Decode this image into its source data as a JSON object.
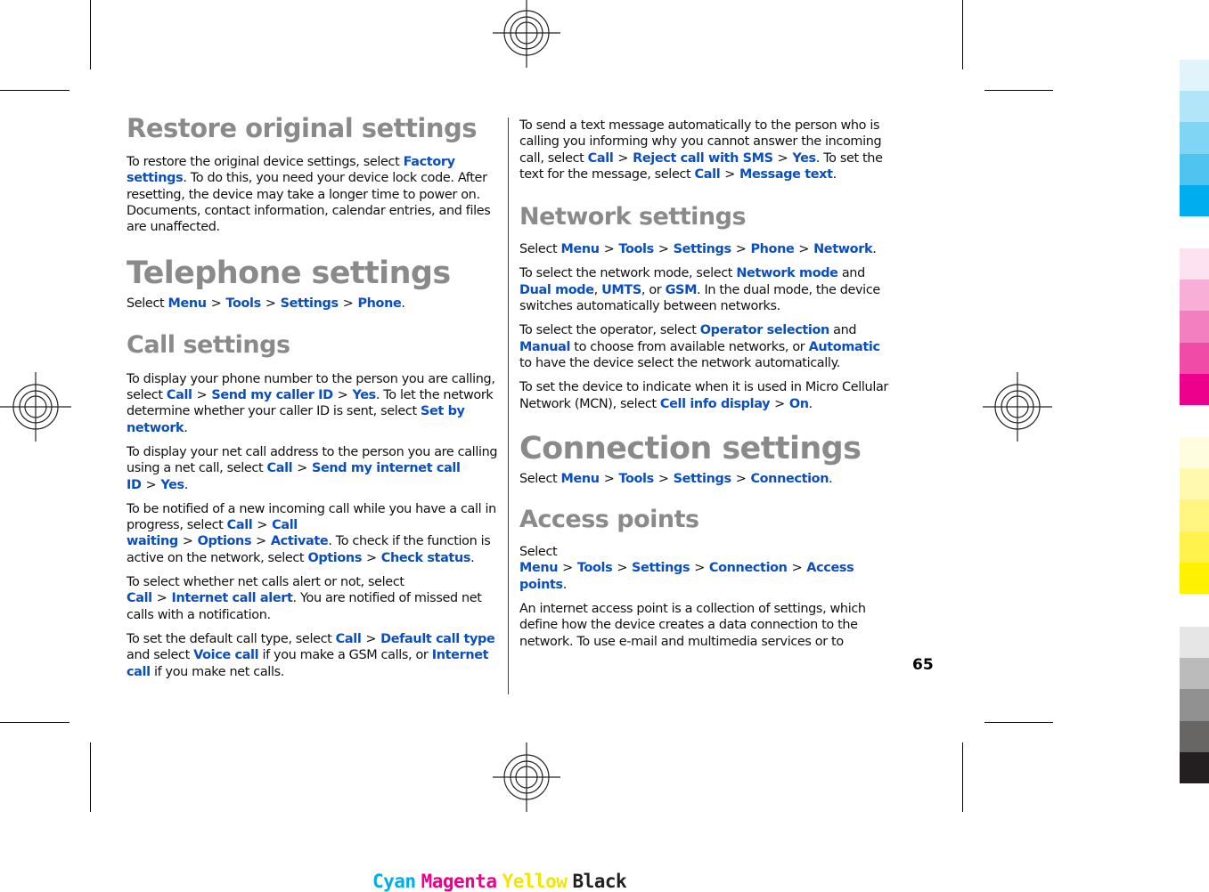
{
  "page_number": "65",
  "left_column": {
    "restore": {
      "title": "Restore original settings",
      "p1": [
        "To restore the original device settings, select ",
        "Factory settings",
        ". To do this, you need your device lock code. After resetting, the device may take a longer time to power on. Documents, contact information, calendar entries, and files are unaffected."
      ]
    },
    "telephone": {
      "title": "Telephone settings",
      "path_prefix": "Select ",
      "path": [
        "Menu",
        "Tools",
        "Settings",
        "Phone"
      ],
      "path_suffix": "."
    },
    "call_settings": {
      "title": "Call settings",
      "p1": {
        "t1": "To display your phone number to the person you are calling, select ",
        "l1": "Call",
        "l2": "Send my caller ID",
        "l3": "Yes",
        "t2": ". To let the network determine whether your caller ID is sent, select ",
        "l4": "Set by network",
        "t3": "."
      },
      "p2": {
        "t1": "To display your net call address to the person you are calling using a net call, select ",
        "l1": "Call",
        "l2": "Send my internet call ID",
        "l3": "Yes",
        "t2": "."
      },
      "p3": {
        "t1": "To be notified of a new incoming call while you have a call in progress, select ",
        "l1": "Call",
        "l2": "Call waiting",
        "l3": "Options",
        "l4": "Activate",
        "t2": ". To check if the function is active on the network, select ",
        "l5": "Options",
        "l6": "Check status",
        "t3": "."
      },
      "p4": {
        "t1": "To select whether net calls alert or not, select ",
        "l1": "Call",
        "l2": "Internet call alert",
        "t2": ". You are notified of missed net calls with a notification."
      },
      "p5": {
        "t1": "To set the default call type, select ",
        "l1": "Call",
        "l2": "Default call type",
        "t2": " and select ",
        "l3": "Voice call",
        "t3": " if you make a GSM calls, or ",
        "l4": "Internet call",
        "t4": " if you make net calls."
      }
    }
  },
  "right_column": {
    "sms": {
      "t1": "To send a text message automatically to the person who is calling you informing why you cannot answer the incoming call, select ",
      "l1": "Call",
      "l2": "Reject call with SMS",
      "l3": "Yes",
      "t2": ". To set the text for the message, select ",
      "l4": "Call",
      "l5": "Message text",
      "t3": "."
    },
    "network": {
      "title": "Network settings",
      "path_prefix": "Select ",
      "path": [
        "Menu",
        "Tools",
        "Settings",
        "Phone",
        "Network"
      ],
      "path_suffix": ".",
      "p1": {
        "t1": "To select the network mode, select ",
        "l1": "Network mode",
        "t2": " and ",
        "l2": "Dual mode",
        "t3": ", ",
        "l3": "UMTS",
        "t4": ", or ",
        "l4": "GSM",
        "t5": ". In the dual mode, the device switches automatically between networks."
      },
      "p2": {
        "t1": "To select the operator, select ",
        "l1": "Operator selection",
        "t2": " and ",
        "l2": "Manual",
        "t3": " to choose from available networks, or ",
        "l3": "Automatic",
        "t4": " to have the device select the network automatically."
      },
      "p3": {
        "t1": "To set the device to indicate when it is used in Micro Cellular Network (MCN), select ",
        "l1": "Cell info display",
        "l2": "On",
        "t2": "."
      }
    },
    "connection": {
      "title": "Connection settings",
      "path_prefix": "Select ",
      "path": [
        "Menu",
        "Tools",
        "Settings",
        "Connection"
      ],
      "path_suffix": "."
    },
    "access_points": {
      "title": "Access points",
      "path_prefix": "Select ",
      "path": [
        "Menu",
        "Tools",
        "Settings",
        "Connection",
        "Access points"
      ],
      "path_suffix": ".",
      "p1": "An internet access point is a collection of settings, which define how the device creates a data connection to the network. To use e-mail and multimedia services or to"
    }
  },
  "separator": ">",
  "print_colors": {
    "cyan": [
      "#e1f4fc",
      "#b3e5f8",
      "#80d5f5",
      "#4fc4f1",
      "#00aeef"
    ],
    "magenta": [
      "#fde3f1",
      "#f8afd7",
      "#f47fc0",
      "#f04ca7",
      "#ec008c"
    ],
    "yellow": [
      "#fffde0",
      "#fff9b0",
      "#fff580",
      "#fff24d",
      "#fff200"
    ],
    "black": [
      "#e6e6e6",
      "#bcbbbb",
      "#929191",
      "#676665",
      "#231f20"
    ]
  },
  "cmyk_label": {
    "cyan": "Cyan",
    "magenta": "Magenta",
    "yellow": "Yellow",
    "black": "Black",
    "cyan_color": "#00aeef",
    "magenta_color": "#ec008c",
    "yellow_color": "#fff200",
    "black_color": "#231f20"
  }
}
